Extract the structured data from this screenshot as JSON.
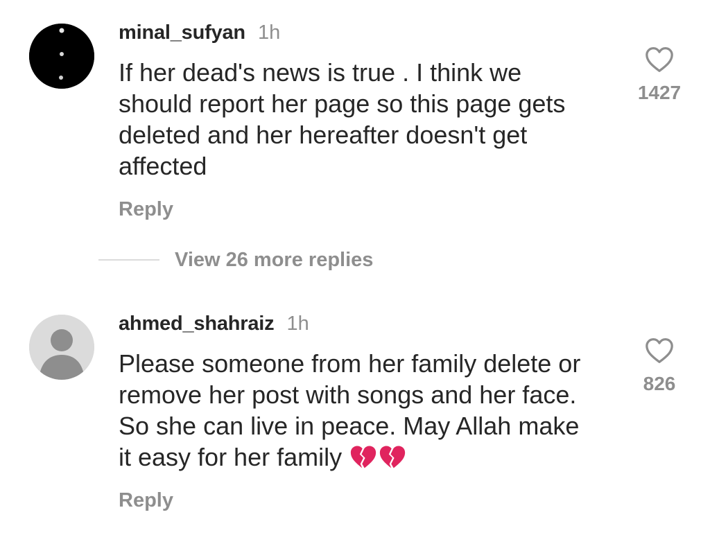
{
  "comments": [
    {
      "username": "minal_sufyan",
      "time": "1h",
      "text": "If her dead's news is true . I think we\nshould report her page so this page gets\ndeleted and her hereafter doesn't get\naffected",
      "reply_label": "Reply",
      "like_count": "1427",
      "avatar": "black-profile-photo"
    },
    {
      "username": "ahmed_shahraiz",
      "time": "1h",
      "text_line1": "Please someone from her family delete or",
      "text_line2": "remove her post with songs and her face.",
      "text_line3": "So she can live in peace. May Allah make",
      "text_line4": "it easy for her family ",
      "emoji": "broken-heart-icon",
      "emoji_count": 2,
      "reply_label": "Reply",
      "like_count": "826",
      "avatar": "default-avatar-icon"
    }
  ],
  "view_replies_label": "View 26 more replies",
  "colors": {
    "text": "#262626",
    "secondary": "#8e8e8e",
    "avatar_placeholder_bg": "#dbdbdb",
    "avatar_placeholder_fg": "#8e8e8e",
    "broken_heart": "#e0245e"
  }
}
